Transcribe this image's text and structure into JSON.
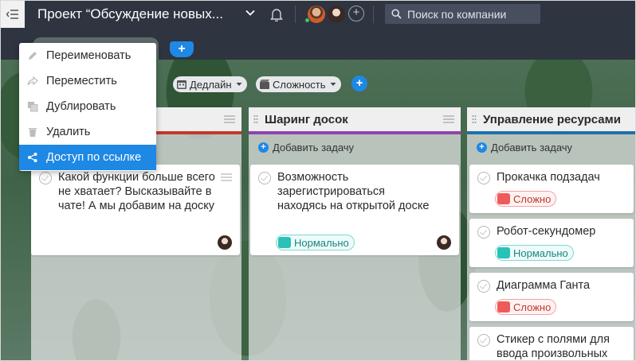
{
  "header": {
    "project_title": "Проект “Обсуждение новых...",
    "search_placeholder": "Поиск по компании"
  },
  "filters": [
    {
      "label": "Дедлайн"
    },
    {
      "label": "Сложность"
    }
  ],
  "context_menu": {
    "items": [
      {
        "label": "Переименовать",
        "icon": "pencil-icon"
      },
      {
        "label": "Переместить",
        "icon": "share-arrow-icon"
      },
      {
        "label": "Дублировать",
        "icon": "copy-icon"
      },
      {
        "label": "Удалить",
        "icon": "trash-icon"
      },
      {
        "label": "Доступ по ссылке",
        "icon": "link-share-icon",
        "active": true
      }
    ]
  },
  "columns": [
    {
      "title": "",
      "color": "#c0392b",
      "cards": [
        {
          "text": "Какой функции больше всего не хватает? Высказывайте в чате! А мы добавим на доску",
          "has_avatar": true
        }
      ]
    },
    {
      "title": "Шаринг досок",
      "color": "#8e44ad",
      "add_task": "Добавить задачу",
      "cards": [
        {
          "text": "Возможность зарегистрироваться находясь на открытой доске",
          "badge": "Нормально",
          "has_avatar": true
        }
      ]
    },
    {
      "title": "Управление ресурсами",
      "color": "#1f6fa6",
      "add_task": "Добавить задачу",
      "cards": [
        {
          "text": "Прокачка подзадач",
          "badge": "Сложно"
        },
        {
          "text": "Робот-секундомер",
          "badge": "Нормально"
        },
        {
          "text": "Диаграмма Ганта",
          "badge": "Сложно"
        },
        {
          "text": "Стикер с полями для ввода произвольных"
        }
      ]
    }
  ],
  "colors": {
    "topbar": "#2e3440",
    "accent": "#1e88e5",
    "hard": "#ee5b5b",
    "normal": "#29c1b8"
  }
}
